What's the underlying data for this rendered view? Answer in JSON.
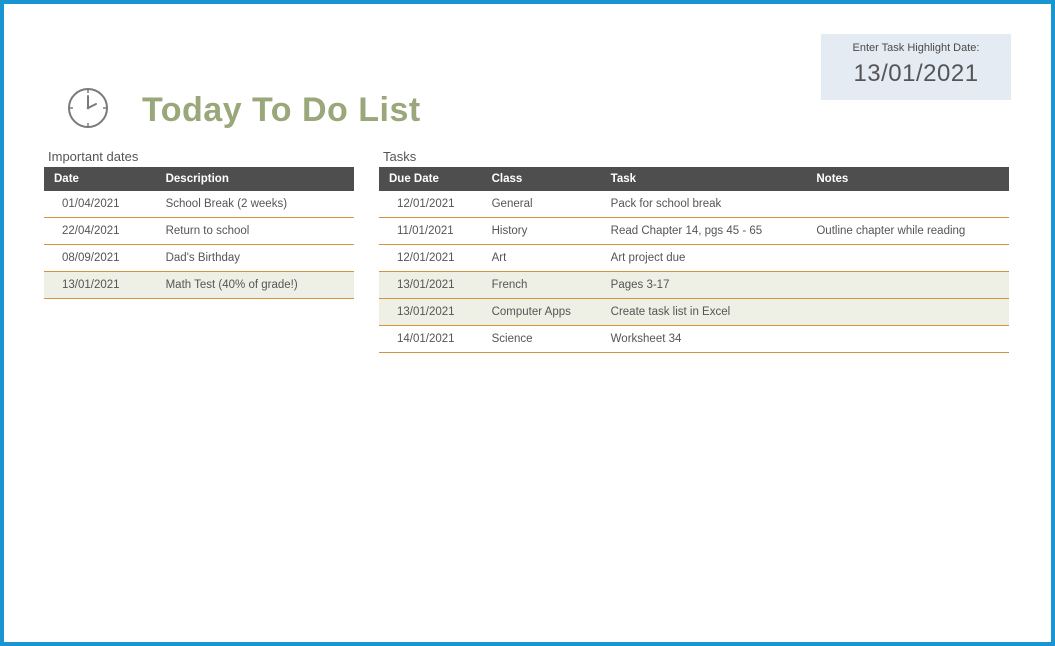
{
  "title": "Today To Do List",
  "highlight": {
    "label": "Enter Task Highlight Date:",
    "date": "13/01/2021"
  },
  "important_dates": {
    "label": "Important dates",
    "columns": {
      "date": "Date",
      "desc": "Description"
    },
    "rows": [
      {
        "date": "01/04/2021",
        "desc": "School Break (2 weeks)",
        "highlight": false
      },
      {
        "date": "22/04/2021",
        "desc": "Return to school",
        "highlight": false
      },
      {
        "date": "08/09/2021",
        "desc": "Dad's Birthday",
        "highlight": false
      },
      {
        "date": "13/01/2021",
        "desc": "Math Test (40% of grade!)",
        "highlight": true
      }
    ]
  },
  "tasks": {
    "label": "Tasks",
    "columns": {
      "due": "Due Date",
      "class": "Class",
      "task": "Task",
      "notes": "Notes"
    },
    "rows": [
      {
        "due": "12/01/2021",
        "class": "General",
        "task": "Pack for school break",
        "notes": "",
        "highlight": false
      },
      {
        "due": "11/01/2021",
        "class": "History",
        "task": "Read Chapter 14, pgs 45 - 65",
        "notes": "Outline chapter while reading",
        "highlight": false
      },
      {
        "due": "12/01/2021",
        "class": "Art",
        "task": "Art project due",
        "notes": "",
        "highlight": false
      },
      {
        "due": "13/01/2021",
        "class": "French",
        "task": "Pages 3-17",
        "notes": "",
        "highlight": true
      },
      {
        "due": "13/01/2021",
        "class": "Computer Apps",
        "task": "Create task list in Excel",
        "notes": "",
        "highlight": true
      },
      {
        "due": "14/01/2021",
        "class": "Science",
        "task": "Worksheet 34",
        "notes": "",
        "highlight": false
      }
    ]
  }
}
